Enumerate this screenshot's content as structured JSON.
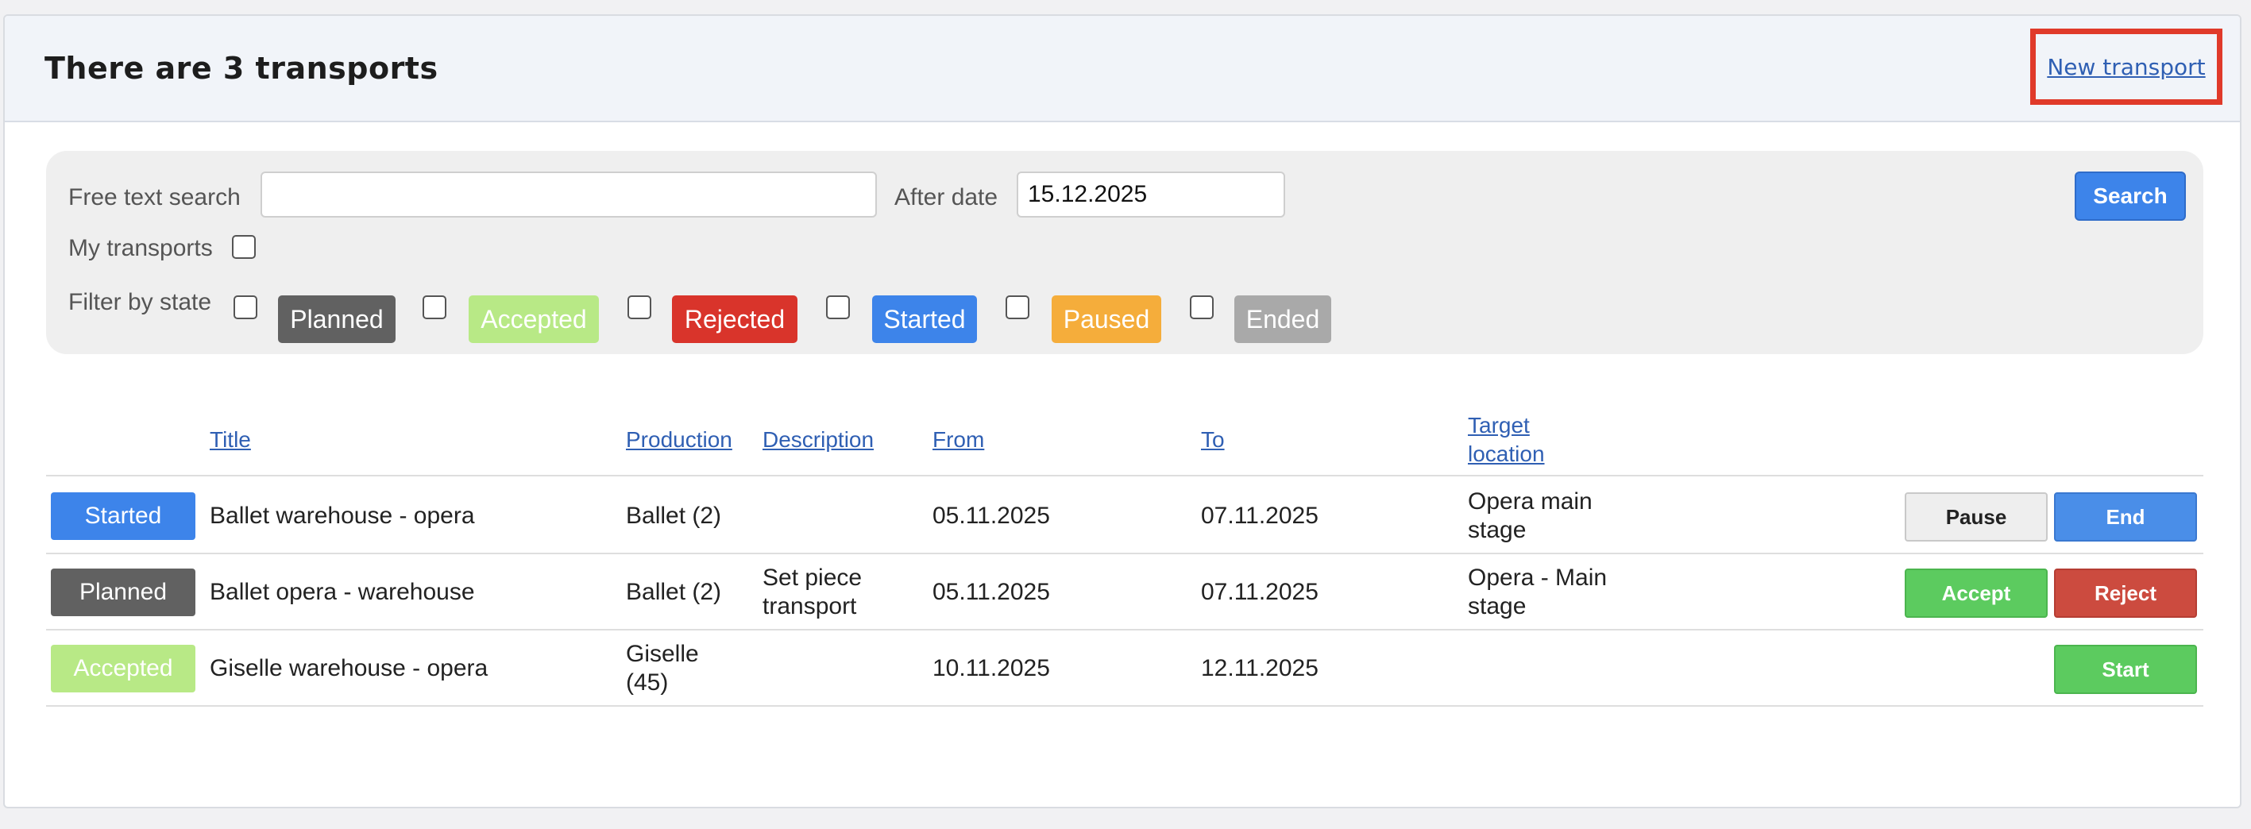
{
  "header": {
    "title": "There are 3 transports",
    "new_transport_label": "New transport"
  },
  "filters": {
    "free_text_label": "Free text search",
    "free_text_value": "",
    "after_date_label": "After date",
    "after_date_value": "15.12.2025",
    "search_label": "Search",
    "my_transports_label": "My transports",
    "filter_by_state_label": "Filter by state",
    "states": [
      {
        "label": "Planned",
        "color": "#616161"
      },
      {
        "label": "Accepted",
        "color": "#b8e986"
      },
      {
        "label": "Rejected",
        "color": "#d9342b"
      },
      {
        "label": "Started",
        "color": "#3d84ea"
      },
      {
        "label": "Paused",
        "color": "#f5ad3b"
      },
      {
        "label": "Ended",
        "color": "#a9a9a9"
      }
    ]
  },
  "table": {
    "columns": [
      "Title",
      "Production",
      "Description",
      "From",
      "To",
      "Target location"
    ],
    "rows": [
      {
        "state": "Started",
        "state_color": "#3d84ea",
        "title": "Ballet warehouse - opera",
        "production": "Ballet (2)",
        "description": "",
        "from": "05.11.2025",
        "to": "07.11.2025",
        "target_location": "Opera main stage",
        "actions": [
          "Pause",
          "End"
        ]
      },
      {
        "state": "Planned",
        "state_color": "#616161",
        "title": "Ballet opera - warehouse",
        "production": "Ballet (2)",
        "description": "Set piece transport",
        "from": "05.11.2025",
        "to": "07.11.2025",
        "target_location": "Opera - Main stage",
        "actions": [
          "Accept",
          "Reject"
        ]
      },
      {
        "state": "Accepted",
        "state_color": "#b8e986",
        "title": "Giselle warehouse - opera",
        "production": "Giselle (45)",
        "description": "",
        "from": "10.11.2025",
        "to": "12.11.2025",
        "target_location": "",
        "actions": [
          "Start"
        ]
      }
    ]
  },
  "colors": {
    "pause_btn": "#eeeeee",
    "end_btn": "#4a8ee8",
    "accept_btn": "#5ccb5f",
    "reject_btn": "#cc4b3f",
    "start_btn": "#5ccb5f",
    "link": "#2f5fb3"
  }
}
